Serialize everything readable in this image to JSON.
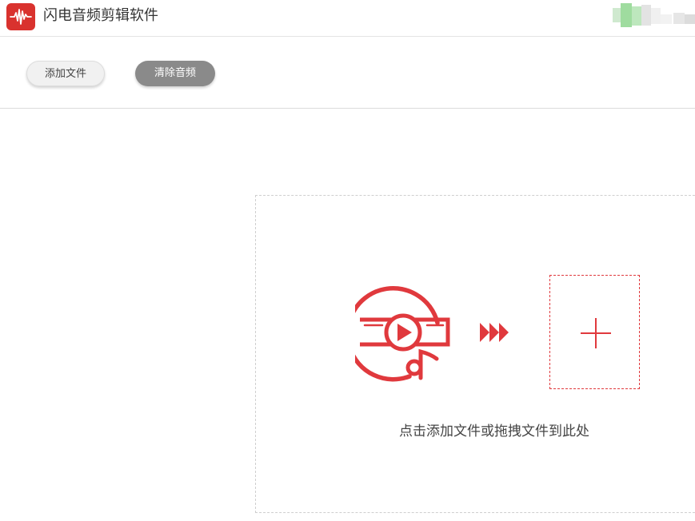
{
  "app": {
    "title": "闪电音频剪辑软件",
    "logo_icon": "waveform-icon",
    "brand_color": "#d9322e"
  },
  "toolbar": {
    "add_file_label": "添加文件",
    "clear_audio_label": "清除音频"
  },
  "dropzone": {
    "hint": "点击添加文件或拖拽文件到此处",
    "file_icon": "video-music-icon",
    "arrow_icon": "fast-forward-icon",
    "add_icon": "plus-icon",
    "accent_color": "#e0393d"
  }
}
